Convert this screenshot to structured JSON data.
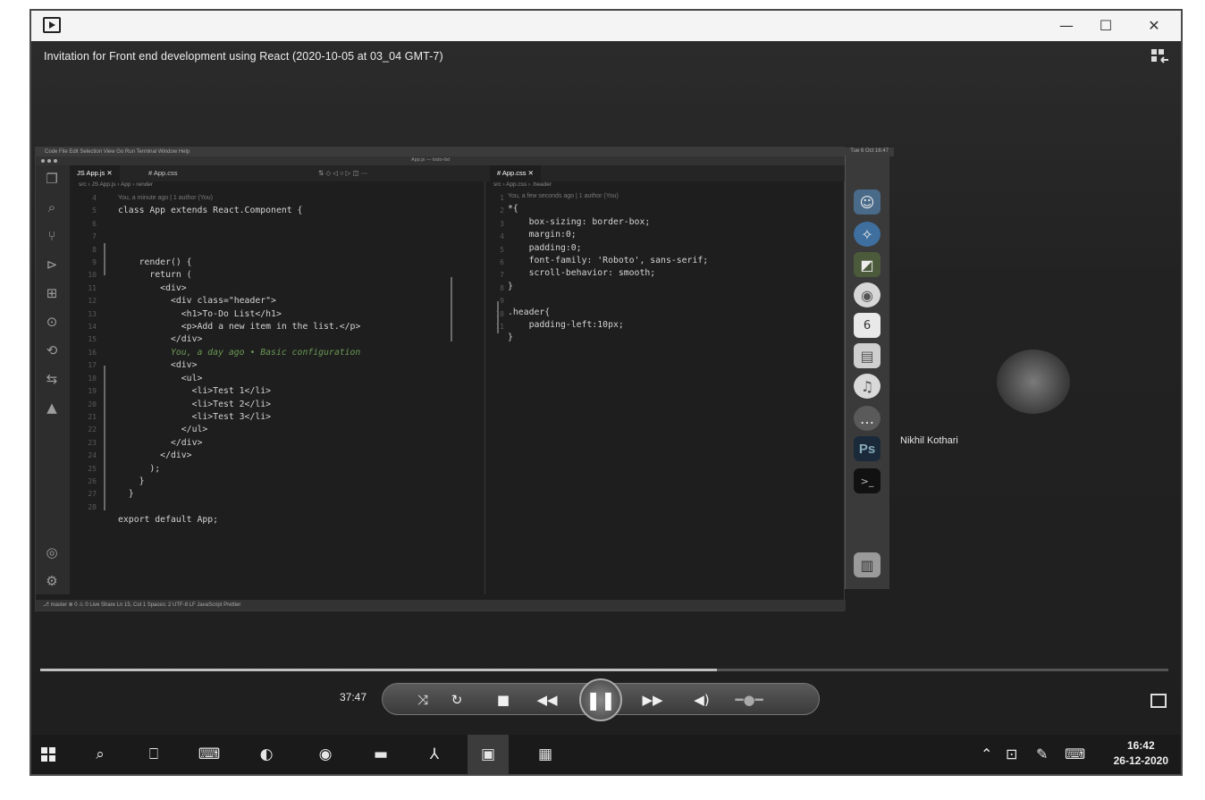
{
  "window": {
    "title": "Invitation for Front end development using React (2020-10-05 at 03_04 GMT-7)",
    "minimize": "—",
    "maximize": "☐",
    "close": "✕"
  },
  "shared_screen": {
    "mac_menu": "Code   File   Edit   Selection   View   Go   Run   Terminal   Window   Help",
    "mac_status": "Tue 6 Oct 16:47",
    "window_title": "App.js — todo-list",
    "left_tab": "App.js",
    "left_tab2": "App.css",
    "right_tab": "App.css",
    "left_breadcrumb": "src › JS App.js › App › render",
    "right_breadcrumb": "src › App.css › .header",
    "left_code": [
      {
        "n": "",
        "blame": "You, a minute ago | 1 author (You)",
        "text": ""
      },
      {
        "n": "4",
        "text": "class App extends React.Component {"
      },
      {
        "n": "5",
        "text": ""
      },
      {
        "n": "6",
        "text": ""
      },
      {
        "n": "7",
        "text": ""
      },
      {
        "n": "8",
        "text": "    render() {"
      },
      {
        "n": "9",
        "text": "      return ("
      },
      {
        "n": "10",
        "text": "        <div>"
      },
      {
        "n": "11",
        "text": "          <div class=\"header\">"
      },
      {
        "n": "12",
        "text": "            <h1>To-Do List</h1>"
      },
      {
        "n": "13",
        "text": "            <p>Add a new item in the list.</p>"
      },
      {
        "n": "14",
        "text": "          </div>"
      },
      {
        "n": "15",
        "text": "          You, a day ago • Basic configuration"
      },
      {
        "n": "16",
        "text": "          <div>"
      },
      {
        "n": "17",
        "text": "            <ul>"
      },
      {
        "n": "18",
        "text": "              <li>Test 1</li>"
      },
      {
        "n": "19",
        "text": "              <li>Test 2</li>"
      },
      {
        "n": "20",
        "text": "              <li>Test 3</li>"
      },
      {
        "n": "21",
        "text": "            </ul>"
      },
      {
        "n": "22",
        "text": "          </div>"
      },
      {
        "n": "23",
        "text": "        </div>"
      },
      {
        "n": "24",
        "text": "      );"
      },
      {
        "n": "25",
        "text": "    }"
      },
      {
        "n": "26",
        "text": "  }"
      },
      {
        "n": "27",
        "text": ""
      },
      {
        "n": "28",
        "text": "export default App;"
      }
    ],
    "right_code": [
      {
        "n": "",
        "text": "You, a few seconds ago | 1 author (You)"
      },
      {
        "n": "1",
        "text": "*{"
      },
      {
        "n": "2",
        "text": "    box-sizing: border-box;"
      },
      {
        "n": "3",
        "text": "    margin:0;"
      },
      {
        "n": "4",
        "text": "    padding:0;"
      },
      {
        "n": "5",
        "text": "    font-family: 'Roboto', sans-serif;"
      },
      {
        "n": "6",
        "text": "    scroll-behavior: smooth;"
      },
      {
        "n": "7",
        "text": "}"
      },
      {
        "n": "8",
        "text": ""
      },
      {
        "n": "9",
        "text": ".header{"
      },
      {
        "n": "10",
        "text": "    padding-left:10px;"
      },
      {
        "n": "11",
        "text": "}"
      }
    ],
    "status": "⎇ master ⊗ 0 ⚠ 0   Live Share   Ln 15, Col 1   Spaces: 2   UTF-8   LF   JavaScript   Prettier"
  },
  "participant": {
    "name": "Nikhil Kothari"
  },
  "player": {
    "time": "37:47",
    "progress": 0.6
  },
  "taskbar": {
    "clock_time": "16:42",
    "clock_date": "26-12-2020"
  }
}
